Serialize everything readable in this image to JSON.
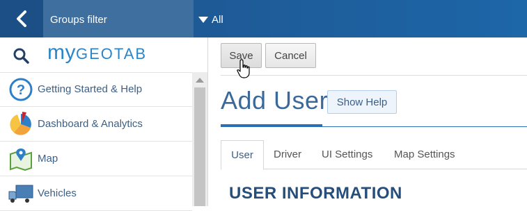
{
  "topbar": {
    "groups_label": "Groups filter",
    "filter_value": "All"
  },
  "sidebar": {
    "logo_my": "my",
    "logo_geotab": "GEOTAB",
    "items": [
      {
        "label": "Getting Started & Help",
        "icon": "help-icon"
      },
      {
        "label": "Dashboard & Analytics",
        "icon": "pie-chart-icon"
      },
      {
        "label": "Map",
        "icon": "map-icon"
      },
      {
        "label": "Vehicles",
        "icon": "truck-icon"
      }
    ]
  },
  "toolbar": {
    "save_label": "Save",
    "cancel_label": "Cancel"
  },
  "page": {
    "title": "Add User",
    "show_help_label": "Show Help",
    "tabs": [
      {
        "label": "User",
        "active": true
      },
      {
        "label": "Driver",
        "active": false
      },
      {
        "label": "UI Settings",
        "active": false
      },
      {
        "label": "Map Settings",
        "active": false
      }
    ],
    "section_title": "USER INFORMATION"
  },
  "colors": {
    "topbar": "#1d66a8",
    "accent": "#2a6fb3",
    "title": "#3b6a9a"
  }
}
